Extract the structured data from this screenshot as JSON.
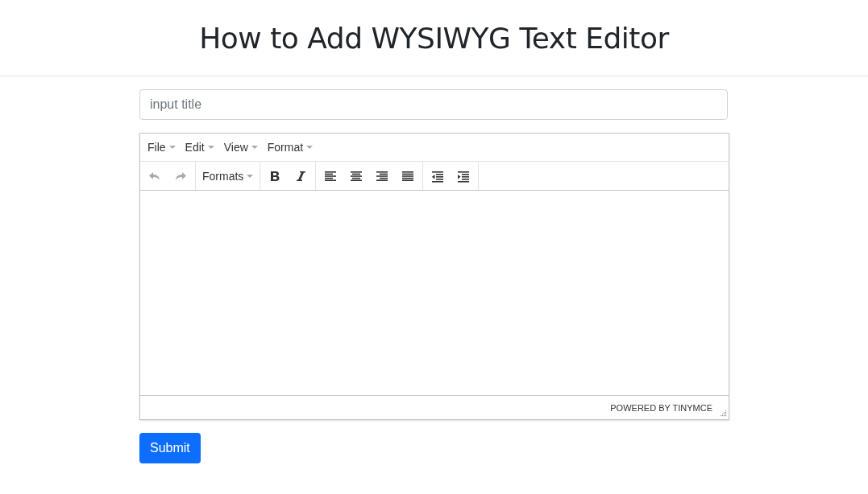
{
  "heading": "How to Add WYSIWYG Text Editor",
  "title_field": {
    "placeholder": "input title"
  },
  "editor": {
    "menu": [
      {
        "label": "File"
      },
      {
        "label": "Edit"
      },
      {
        "label": "View"
      },
      {
        "label": "Format"
      }
    ],
    "toolbar": [
      [
        {
          "kind": "undo",
          "disabled": true
        },
        {
          "kind": "redo",
          "disabled": true
        }
      ],
      [
        {
          "kind": "dropdown",
          "label": "Formats",
          "disabled": false
        }
      ],
      [
        {
          "kind": "bold",
          "disabled": false
        },
        {
          "kind": "italic",
          "disabled": false
        }
      ],
      [
        {
          "kind": "align-left",
          "disabled": false
        },
        {
          "kind": "align-center",
          "disabled": false
        },
        {
          "kind": "align-right",
          "disabled": false
        },
        {
          "kind": "justify",
          "disabled": false
        }
      ],
      [
        {
          "kind": "outdent",
          "disabled": false
        },
        {
          "kind": "indent",
          "disabled": false
        }
      ]
    ],
    "status": "POWERED BY TINYMCE"
  },
  "submit": "Submit"
}
